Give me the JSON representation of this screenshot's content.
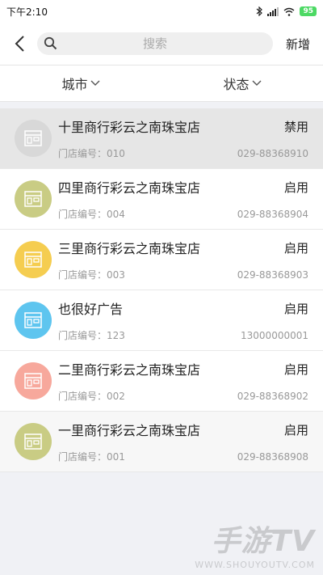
{
  "statusbar": {
    "time": "下午2:10",
    "battery": "95"
  },
  "navbar": {
    "search_placeholder": "搜索",
    "add_label": "新增"
  },
  "filters": [
    {
      "label": "城市"
    },
    {
      "label": "状态"
    }
  ],
  "stores": [
    {
      "name": "十里商行彩云之南珠宝店",
      "status": "禁用",
      "code": "门店编号：010",
      "phone": "029-88368910",
      "color": "#d8d8d8"
    },
    {
      "name": "四里商行彩云之南珠宝店",
      "status": "启用",
      "code": "门店编号：004",
      "phone": "029-88368904",
      "color": "#c9cc84"
    },
    {
      "name": "三里商行彩云之南珠宝店",
      "status": "启用",
      "code": "门店编号：003",
      "phone": "029-88368903",
      "color": "#f5cd50"
    },
    {
      "name": "也很好广告",
      "status": "启用",
      "code": "门店编号：123",
      "phone": "13000000001",
      "color": "#5ec5ef"
    },
    {
      "name": "二里商行彩云之南珠宝店",
      "status": "启用",
      "code": "门店编号：002",
      "phone": "029-88368902",
      "color": "#f7a89c"
    },
    {
      "name": "一里商行彩云之南珠宝店",
      "status": "启用",
      "code": "门店编号：001",
      "phone": "029-88368908",
      "color": "#c9cc84"
    }
  ],
  "watermark": {
    "title": "手游TV",
    "url": "WWW.SHOUYOUTV.COM"
  }
}
